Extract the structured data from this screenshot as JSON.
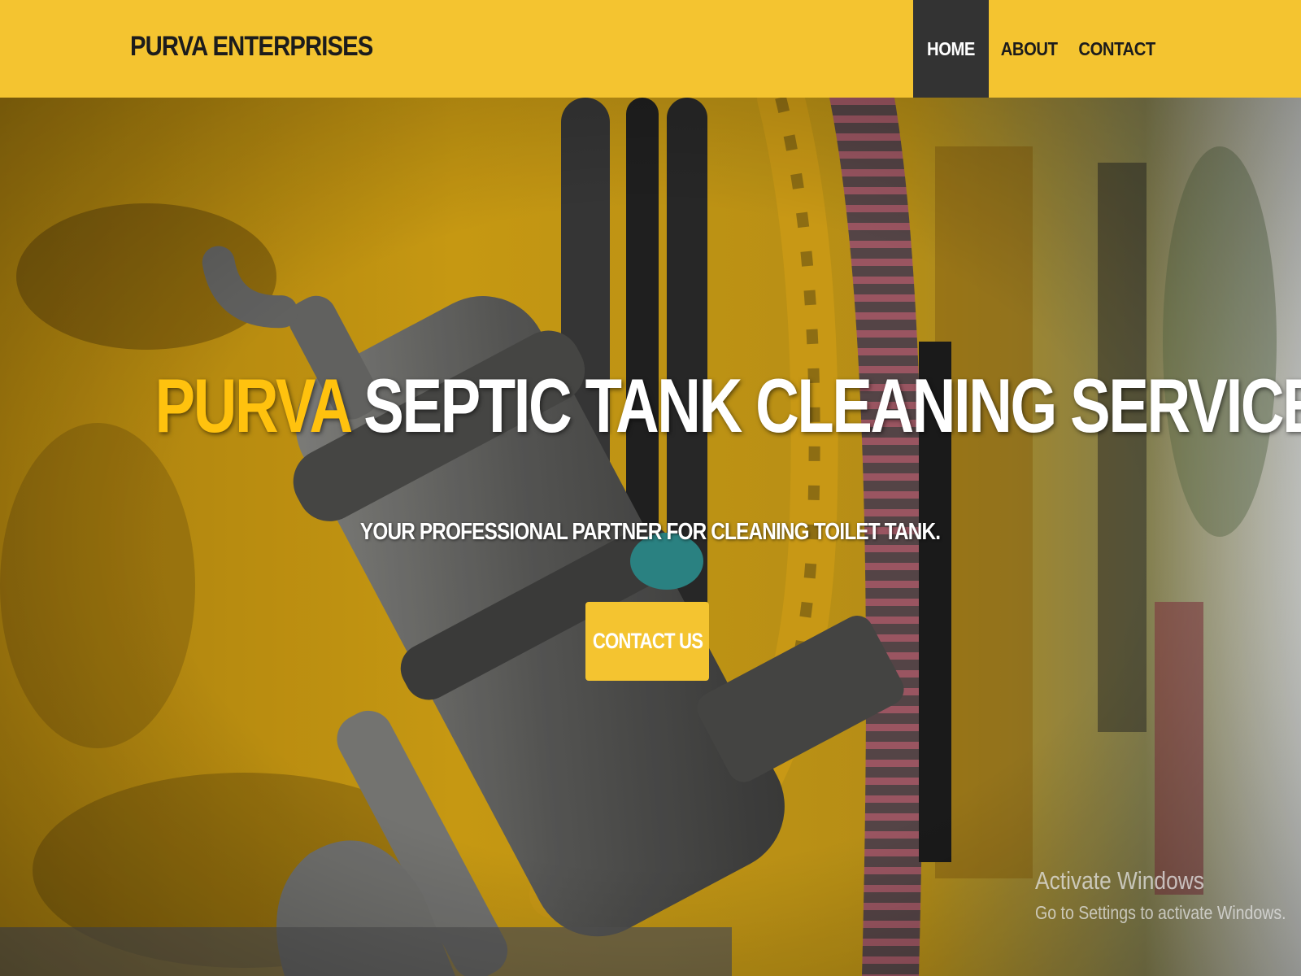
{
  "header": {
    "brand": "PURVA ENTERPRISES",
    "nav": [
      {
        "label": "HOME",
        "active": true
      },
      {
        "label": "ABOUT",
        "active": false
      },
      {
        "label": "CONTACT",
        "active": false
      }
    ]
  },
  "hero": {
    "title_accent": "PURVA",
    "title_rest": " SEPTIC TANK CLEANING SERVICE",
    "subtitle": "YOUR PROFESSIONAL PARTNER FOR CLEANING TOILET TANK.",
    "cta_label": "CONTACT US",
    "background_image": "septic-truck-hose-coupling-photo"
  },
  "overlay": {
    "title": "Activate Windows",
    "subtitle": "Go to Settings to activate Windows."
  },
  "colors": {
    "brand_yellow": "#f4c430",
    "accent_yellow": "#ffc20e",
    "active_nav": "#333333",
    "text_dark": "#1c1c1c",
    "text_light": "#ffffff"
  }
}
